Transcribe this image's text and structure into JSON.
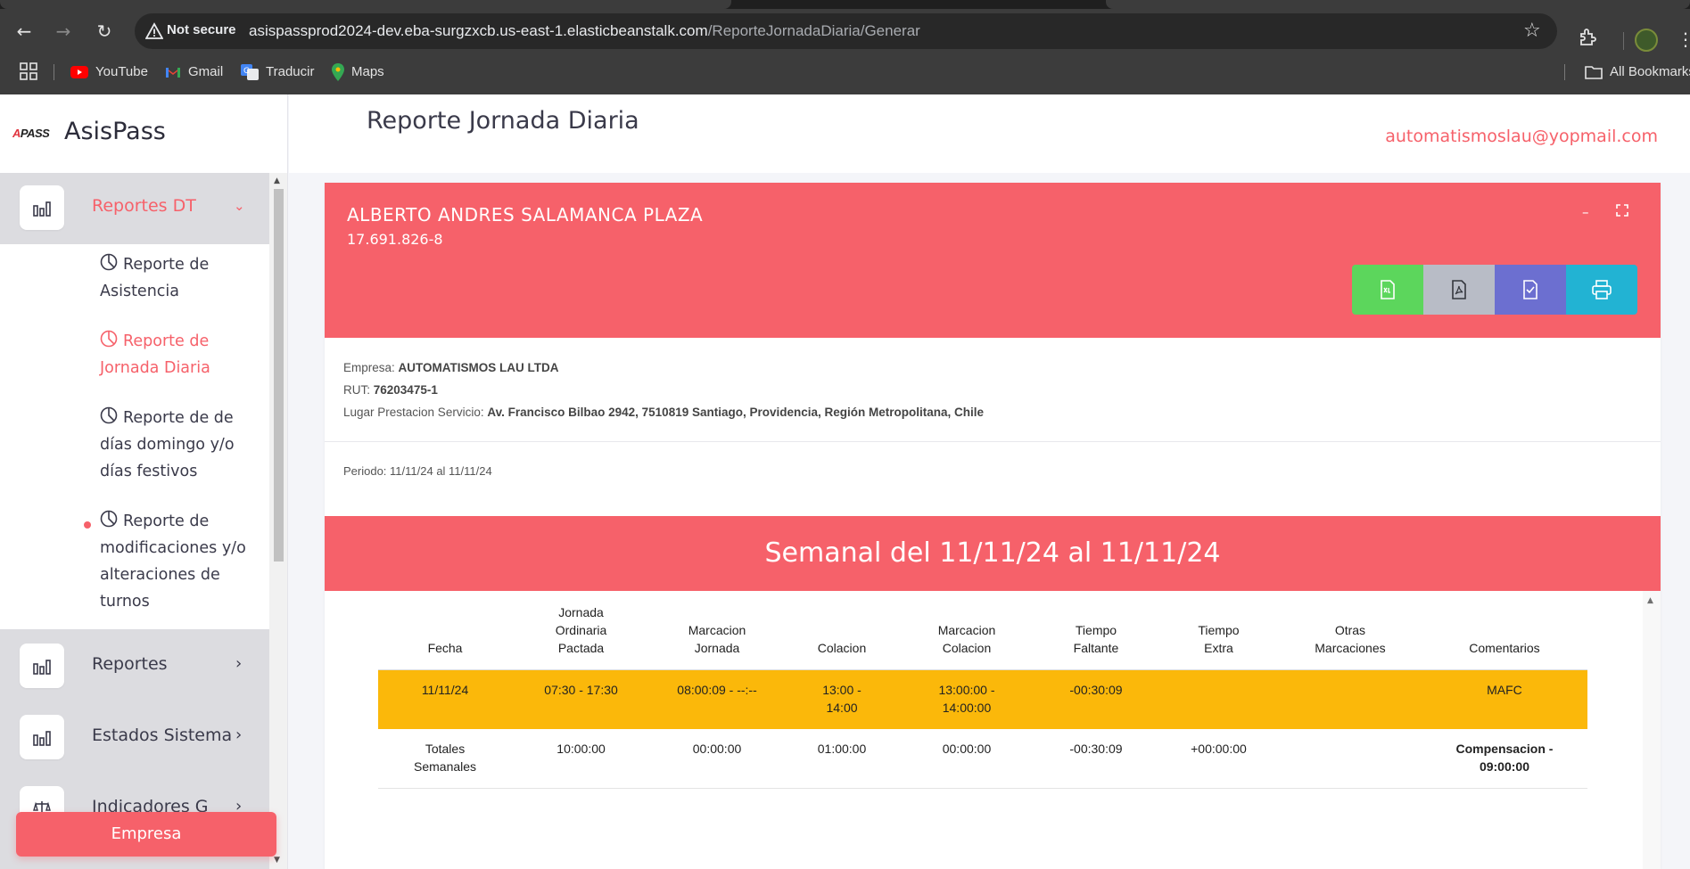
{
  "browser": {
    "security_label": "Not secure",
    "url_host": "asispassprod2024-dev.eba-surgzxcb.us-east-1.elasticbeanstalk.com",
    "url_path": "/ReporteJornadaDiaria/Generar",
    "bookmarks": [
      {
        "label": "YouTube",
        "icon": "youtube-icon"
      },
      {
        "label": "Gmail",
        "icon": "gmail-icon"
      },
      {
        "label": "Traducir",
        "icon": "translate-icon"
      },
      {
        "label": "Maps",
        "icon": "maps-icon"
      }
    ],
    "all_bookmarks_label": "All Bookmarks"
  },
  "brand": {
    "logo_text_a": "A",
    "logo_text_b": "PASS",
    "name": "AsisPass"
  },
  "sidebar": {
    "active_group": {
      "label": "Reportes DT",
      "icon": "bar-chart-icon"
    },
    "sub_items": [
      {
        "label": "Reporte de Asistencia",
        "active": false
      },
      {
        "label": "Reporte de Jornada Diaria",
        "active": true
      },
      {
        "label": "Reporte de de días domingo y/o días festivos",
        "active": false
      },
      {
        "label": "Reporte de modificaciones y/o alteraciones de turnos",
        "active": false
      }
    ],
    "groups": [
      {
        "label": "Reportes",
        "icon": "bar-chart-icon"
      },
      {
        "label": "Estados Sistema",
        "icon": "bar-chart-icon"
      },
      {
        "label": "Indicadores G",
        "icon": "scale-icon"
      }
    ],
    "empresa_button": "Empresa"
  },
  "header": {
    "title": "Reporte Jornada Diaria",
    "user_email": "automatismoslau@yopmail.com"
  },
  "employee": {
    "name": "ALBERTO ANDRES SALAMANCA PLAZA",
    "rut": "17.691.826-8"
  },
  "export_buttons": [
    {
      "name": "xls",
      "color": "#5cd65c"
    },
    {
      "name": "pdf",
      "color": "#b8bcc6"
    },
    {
      "name": "signed-doc",
      "color": "#6c6fd0"
    },
    {
      "name": "print",
      "color": "#22b3d3"
    }
  ],
  "company": {
    "empresa_label": "Empresa:",
    "empresa_value": "AUTOMATISMOS LAU LTDA",
    "rut_label": "RUT:",
    "rut_value": "76203475-1",
    "lugar_label": "Lugar Prestacion Servicio:",
    "lugar_value": "Av. Francisco Bilbao 2942, 7510819 Santiago, Providencia, Región Metropolitana, Chile"
  },
  "periodo": "Periodo: 11/11/24 al 11/11/24",
  "week_title": "Semanal del 11/11/24 al 11/11/24",
  "table": {
    "headers": [
      "Fecha",
      "Jornada Ordinaria Pactada",
      "Marcacion Jornada",
      "Colacion",
      "Marcacion Colacion",
      "Tiempo Faltante",
      "Tiempo Extra",
      "Otras Marcaciones",
      "Comentarios"
    ],
    "rows": [
      [
        "11/11/24",
        "07:30 - 17:30",
        "08:00:09 - --:--",
        "13:00 - 14:00",
        "13:00:00 - 14:00:00",
        "-00:30:09",
        "",
        "",
        "MAFC"
      ]
    ],
    "totals": [
      "Totales Semanales",
      "10:00:00",
      "00:00:00",
      "01:00:00",
      "00:00:00",
      "-00:30:09",
      "+00:00:00",
      "",
      "Compensacion - 09:00:00"
    ]
  },
  "colors": {
    "accent": "#f6616a",
    "highlight_row": "#fbb80a"
  }
}
